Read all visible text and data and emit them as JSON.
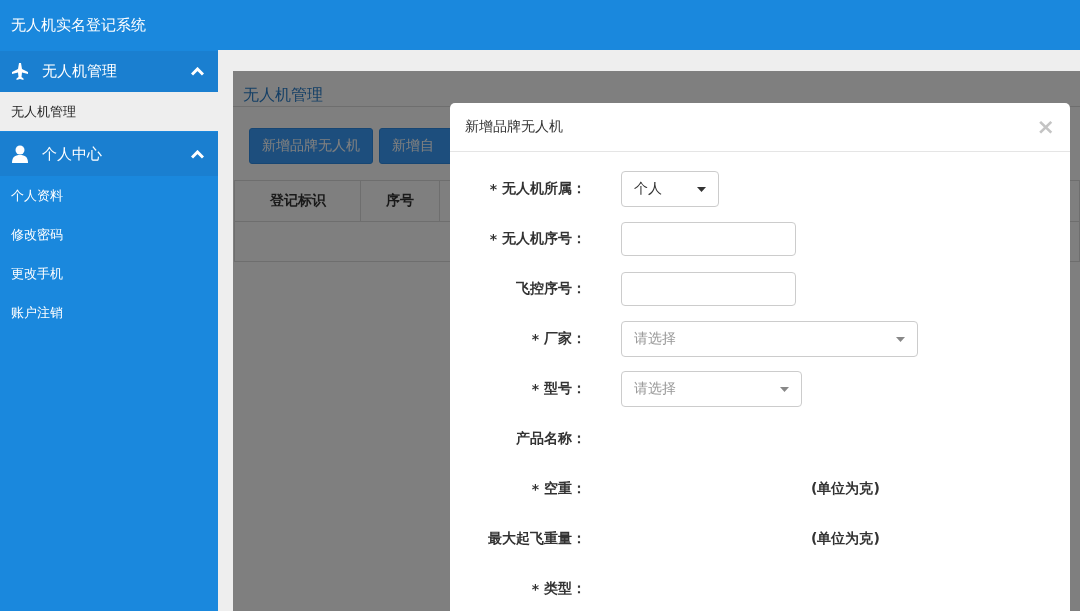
{
  "header": {
    "title": "无人机实名登记系统"
  },
  "sidebar": {
    "groups": [
      {
        "label": "无人机管理",
        "expanded": true,
        "items": [
          {
            "label": "无人机管理",
            "selected": true
          }
        ]
      },
      {
        "label": "个人中心",
        "expanded": true,
        "items": [
          {
            "label": "个人资料",
            "selected": false
          },
          {
            "label": "修改密码",
            "selected": false
          },
          {
            "label": "更改手机",
            "selected": false
          },
          {
            "label": "账户注销",
            "selected": false
          }
        ]
      }
    ]
  },
  "panel": {
    "title": "无人机管理",
    "buttons": [
      "新增品牌无人机",
      "新增自"
    ],
    "table": {
      "columns": [
        "登记标识",
        "序号"
      ]
    }
  },
  "dialog": {
    "title": "新增品牌无人机",
    "close": "×",
    "fields": [
      {
        "kind": "select",
        "required_mark": "*",
        "label": "无人机所属：",
        "value": "个人"
      },
      {
        "kind": "input",
        "required_mark": "*",
        "label": "无人机序号："
      },
      {
        "kind": "input",
        "label": "飞控序号："
      },
      {
        "kind": "select",
        "required_mark": "*",
        "label": "厂家：",
        "placeholder": "请选择",
        "wide": true
      },
      {
        "kind": "select",
        "required_mark": "*",
        "label": "型号：",
        "placeholder": "请选择",
        "wide": false
      },
      {
        "kind": "text",
        "label": "产品名称："
      },
      {
        "kind": "unit",
        "required_mark": "*",
        "label": "空重：",
        "unit": "(单位为克)"
      },
      {
        "kind": "unit",
        "label": "最大起飞重量：",
        "unit": "(单位为克)"
      },
      {
        "kind": "text",
        "required_mark": "*",
        "label": "类型："
      }
    ]
  }
}
